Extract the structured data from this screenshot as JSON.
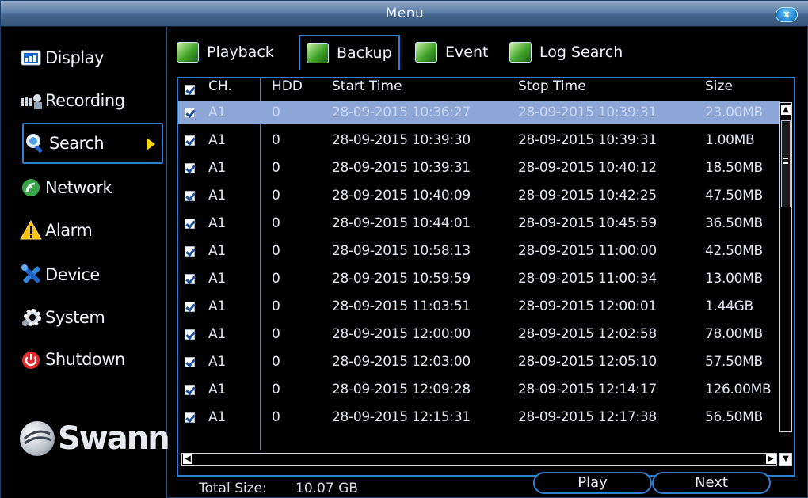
{
  "window": {
    "title": "Menu",
    "close_glyph": "x"
  },
  "sidebar": {
    "items": [
      {
        "label": "Display",
        "icon": "display-icon"
      },
      {
        "label": "Recording",
        "icon": "recording-icon"
      },
      {
        "label": "Search",
        "icon": "search-icon",
        "active": true
      },
      {
        "label": "Network",
        "icon": "network-icon"
      },
      {
        "label": "Alarm",
        "icon": "alarm-icon"
      },
      {
        "label": "Device",
        "icon": "device-icon"
      },
      {
        "label": "System",
        "icon": "system-icon"
      },
      {
        "label": "Shutdown",
        "icon": "shutdown-icon"
      }
    ],
    "logo_text": "Swann"
  },
  "tabs": [
    {
      "label": "Playback"
    },
    {
      "label": "Backup",
      "active": true
    },
    {
      "label": "Event"
    },
    {
      "label": "Log Search"
    }
  ],
  "table": {
    "headers": {
      "ch": "CH.",
      "hdd": "HDD",
      "start": "Start Time",
      "stop": "Stop Time",
      "size": "Size"
    },
    "rows": [
      {
        "ch": "A1",
        "hdd": "0",
        "start": "28-09-2015 10:36:27",
        "stop": "28-09-2015 10:39:31",
        "size": "23.00MB",
        "selected": true
      },
      {
        "ch": "A1",
        "hdd": "0",
        "start": "28-09-2015 10:39:30",
        "stop": "28-09-2015 10:39:31",
        "size": "1.00MB"
      },
      {
        "ch": "A1",
        "hdd": "0",
        "start": "28-09-2015 10:39:31",
        "stop": "28-09-2015 10:40:12",
        "size": "18.50MB"
      },
      {
        "ch": "A1",
        "hdd": "0",
        "start": "28-09-2015 10:40:09",
        "stop": "28-09-2015 10:42:25",
        "size": "47.50MB"
      },
      {
        "ch": "A1",
        "hdd": "0",
        "start": "28-09-2015 10:44:01",
        "stop": "28-09-2015 10:45:59",
        "size": "36.50MB"
      },
      {
        "ch": "A1",
        "hdd": "0",
        "start": "28-09-2015 10:58:13",
        "stop": "28-09-2015 11:00:00",
        "size": "42.50MB"
      },
      {
        "ch": "A1",
        "hdd": "0",
        "start": "28-09-2015 10:59:59",
        "stop": "28-09-2015 11:00:34",
        "size": "13.00MB"
      },
      {
        "ch": "A1",
        "hdd": "0",
        "start": "28-09-2015 11:03:51",
        "stop": "28-09-2015 12:00:01",
        "size": "1.44GB"
      },
      {
        "ch": "A1",
        "hdd": "0",
        "start": "28-09-2015 12:00:00",
        "stop": "28-09-2015 12:02:58",
        "size": "78.00MB"
      },
      {
        "ch": "A1",
        "hdd": "0",
        "start": "28-09-2015 12:03:00",
        "stop": "28-09-2015 12:05:10",
        "size": "57.50MB"
      },
      {
        "ch": "A1",
        "hdd": "0",
        "start": "28-09-2015 12:09:28",
        "stop": "28-09-2015 12:14:17",
        "size": "126.00MB"
      },
      {
        "ch": "A1",
        "hdd": "0",
        "start": "28-09-2015 12:15:31",
        "stop": "28-09-2015 12:17:38",
        "size": "56.50MB"
      }
    ]
  },
  "footer": {
    "total_label": "Total Size:",
    "total_value": "10.07 GB",
    "play_label": "Play",
    "next_label": "Next"
  }
}
